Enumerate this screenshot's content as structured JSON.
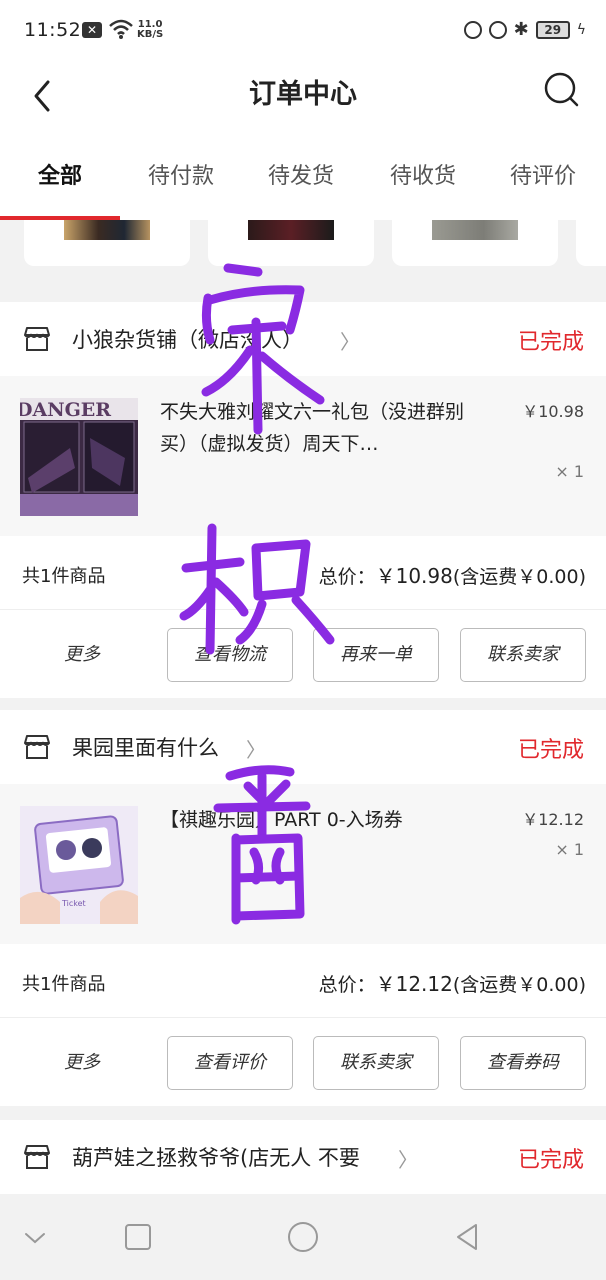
{
  "status_bar": {
    "time": "11:52",
    "net_speed_value": "11.0",
    "net_speed_unit": "KB/S",
    "battery": "29"
  },
  "header": {
    "title": "订单中心",
    "back_icon": "chevron-left-icon",
    "search_icon": "search-icon"
  },
  "tabs": [
    {
      "label": "全部",
      "active": true
    },
    {
      "label": "待付款",
      "active": false
    },
    {
      "label": "待发货",
      "active": false
    },
    {
      "label": "待收货",
      "active": false
    },
    {
      "label": "待评价",
      "active": false
    }
  ],
  "orders": [
    {
      "shop_name": "小狼杂货铺（微店没人）",
      "status": "已完成",
      "item_title": "不失大雅刘耀文六一礼包（没进群别买）（虚拟发货）周天下…",
      "price": "￥10.98",
      "quantity": "× 1",
      "count_label": "共1件商品",
      "total_label": "总价：",
      "total_price": "￥10.98",
      "shipping_note": "(含运费￥0.00)",
      "more": "更多",
      "actions": [
        "查看物流",
        "再来一单",
        "联系卖家"
      ]
    },
    {
      "shop_name": "果园里面有什么",
      "status": "已完成",
      "item_title": "【祺趣乐园】PART 0-入场券",
      "price": "￥12.12",
      "quantity": "× 1",
      "count_label": "共1件商品",
      "total_label": "总价：",
      "total_price": "￥12.12",
      "shipping_note": "(含运费￥0.00)",
      "more": "更多",
      "actions": [
        "查看评价",
        "联系卖家",
        "查看券码"
      ]
    },
    {
      "shop_name": "葫芦娃之拯救爷爷(店无人 不要",
      "status": "已完成"
    }
  ],
  "colors": {
    "accent": "#e1282d",
    "handwriting": "#8a2be2"
  }
}
